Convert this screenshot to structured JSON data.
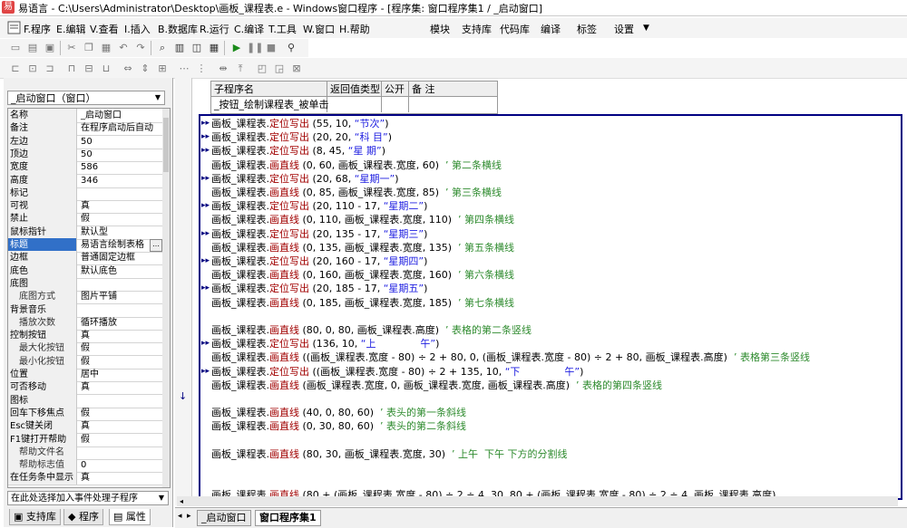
{
  "window": {
    "title": "易语言 - C:\\Users\\Administrator\\Desktop\\画板_课程表.e - Windows窗口程序 - [程序集: 窗口程序集1 / _启动窗口]"
  },
  "menu": {
    "items": [
      "F.程序",
      "E.编辑",
      "V.查看",
      "I.插入",
      "B.数据库",
      "R.运行",
      "C.编译",
      "T.工具",
      "W.窗口",
      "H.帮助"
    ],
    "right_items": [
      "模块",
      "支持库",
      "代码库",
      "编译",
      "标签",
      "设置"
    ]
  },
  "left_panel": {
    "object_select": "_启动窗口（窗口）",
    "properties": [
      {
        "name": "名称",
        "value": "_启动窗口",
        "sub": false
      },
      {
        "name": "备注",
        "value": "在程序启动后自动",
        "sub": false
      },
      {
        "name": "左边",
        "value": "50",
        "sub": false
      },
      {
        "name": "顶边",
        "value": "50",
        "sub": false
      },
      {
        "name": "宽度",
        "value": "586",
        "sub": false
      },
      {
        "name": "高度",
        "value": "346",
        "sub": false
      },
      {
        "name": "标记",
        "value": "",
        "sub": false
      },
      {
        "name": "可视",
        "value": "真",
        "sub": false
      },
      {
        "name": "禁止",
        "value": "假",
        "sub": false
      },
      {
        "name": "鼠标指针",
        "value": "默认型",
        "sub": false
      },
      {
        "name": "标题",
        "value": "易语言绘制表格",
        "sub": false,
        "selected": true
      },
      {
        "name": "边框",
        "value": "普通固定边框",
        "sub": false
      },
      {
        "name": "底色",
        "value": "默认底色",
        "sub": false
      },
      {
        "name": "底图",
        "value": "",
        "sub": false
      },
      {
        "name": "底图方式",
        "value": "图片平铺",
        "sub": true
      },
      {
        "name": "背景音乐",
        "value": "",
        "sub": false
      },
      {
        "name": "播放次数",
        "value": "循环播放",
        "sub": true
      },
      {
        "name": "控制按钮",
        "value": "真",
        "sub": false
      },
      {
        "name": "最大化按钮",
        "value": "假",
        "sub": true
      },
      {
        "name": "最小化按钮",
        "value": "假",
        "sub": true
      },
      {
        "name": "位置",
        "value": "居中",
        "sub": false
      },
      {
        "name": "可否移动",
        "value": "真",
        "sub": false
      },
      {
        "name": "图标",
        "value": "",
        "sub": false
      },
      {
        "name": "回车下移焦点",
        "value": "假",
        "sub": false
      },
      {
        "name": "Esc键关闭",
        "value": "真",
        "sub": false
      },
      {
        "name": "F1键打开帮助",
        "value": "假",
        "sub": false
      },
      {
        "name": "帮助文件名",
        "value": "",
        "sub": true
      },
      {
        "name": "帮助标志值",
        "value": "0",
        "sub": true
      },
      {
        "name": "在任务条中显示",
        "value": "真",
        "sub": false
      }
    ],
    "event_select": "在此处选择加入事件处理子程序",
    "tabs": [
      "支持库",
      "程序",
      "属性"
    ]
  },
  "sub_table": {
    "headers": [
      "子程序名",
      "返回值类型",
      "公开",
      "备 注"
    ],
    "name": "_按钮_绘制课程表_被单击"
  },
  "code_lines": [
    {
      "mark": true,
      "parts": [
        [
          "画板_课程表.",
          ""
        ],
        [
          "定位写出",
          "kw"
        ],
        [
          " (55, 10, ",
          ""
        ],
        [
          "“节次”",
          "str"
        ],
        [
          ")",
          ""
        ]
      ]
    },
    {
      "mark": true,
      "parts": [
        [
          "画板_课程表.",
          ""
        ],
        [
          "定位写出",
          "kw"
        ],
        [
          " (20, 20, ",
          ""
        ],
        [
          "“科 目”",
          "str"
        ],
        [
          ")",
          ""
        ]
      ]
    },
    {
      "mark": true,
      "parts": [
        [
          "画板_课程表.",
          ""
        ],
        [
          "定位写出",
          "kw"
        ],
        [
          " (8, 45, ",
          ""
        ],
        [
          "“星 期”",
          "str"
        ],
        [
          ")",
          ""
        ]
      ]
    },
    {
      "mark": false,
      "parts": [
        [
          "画板_课程表.",
          ""
        ],
        [
          "画直线",
          "kw"
        ],
        [
          " (0, 60, 画板_课程表.宽度, 60)  ",
          ""
        ],
        [
          "’ 第二条横线",
          "cmt"
        ]
      ]
    },
    {
      "mark": true,
      "parts": [
        [
          "画板_课程表.",
          ""
        ],
        [
          "定位写出",
          "kw"
        ],
        [
          " (20, 68, ",
          ""
        ],
        [
          "“星期一”",
          "str"
        ],
        [
          ")",
          ""
        ]
      ]
    },
    {
      "mark": false,
      "parts": [
        [
          "画板_课程表.",
          ""
        ],
        [
          "画直线",
          "kw"
        ],
        [
          " (0, 85, 画板_课程表.宽度, 85)  ",
          ""
        ],
        [
          "’ 第三条横线",
          "cmt"
        ]
      ]
    },
    {
      "mark": true,
      "parts": [
        [
          "画板_课程表.",
          ""
        ],
        [
          "定位写出",
          "kw"
        ],
        [
          " (20, 110 - 17, ",
          ""
        ],
        [
          "“星期二”",
          "str"
        ],
        [
          ")",
          ""
        ]
      ]
    },
    {
      "mark": false,
      "parts": [
        [
          "画板_课程表.",
          ""
        ],
        [
          "画直线",
          "kw"
        ],
        [
          " (0, 110, 画板_课程表.宽度, 110)  ",
          ""
        ],
        [
          "’ 第四条横线",
          "cmt"
        ]
      ]
    },
    {
      "mark": true,
      "parts": [
        [
          "画板_课程表.",
          ""
        ],
        [
          "定位写出",
          "kw"
        ],
        [
          " (20, 135 - 17, ",
          ""
        ],
        [
          "“星期三”",
          "str"
        ],
        [
          ")",
          ""
        ]
      ]
    },
    {
      "mark": false,
      "parts": [
        [
          "画板_课程表.",
          ""
        ],
        [
          "画直线",
          "kw"
        ],
        [
          " (0, 135, 画板_课程表.宽度, 135)  ",
          ""
        ],
        [
          "’ 第五条横线",
          "cmt"
        ]
      ]
    },
    {
      "mark": true,
      "parts": [
        [
          "画板_课程表.",
          ""
        ],
        [
          "定位写出",
          "kw"
        ],
        [
          " (20, 160 - 17, ",
          ""
        ],
        [
          "“星期四”",
          "str"
        ],
        [
          ")",
          ""
        ]
      ]
    },
    {
      "mark": false,
      "parts": [
        [
          "画板_课程表.",
          ""
        ],
        [
          "画直线",
          "kw"
        ],
        [
          " (0, 160, 画板_课程表.宽度, 160)  ",
          ""
        ],
        [
          "’ 第六条横线",
          "cmt"
        ]
      ]
    },
    {
      "mark": true,
      "parts": [
        [
          "画板_课程表.",
          ""
        ],
        [
          "定位写出",
          "kw"
        ],
        [
          " (20, 185 - 17, ",
          ""
        ],
        [
          "“星期五”",
          "str"
        ],
        [
          ")",
          ""
        ]
      ]
    },
    {
      "mark": false,
      "parts": [
        [
          "画板_课程表.",
          ""
        ],
        [
          "画直线",
          "kw"
        ],
        [
          " (0, 185, 画板_课程表.宽度, 185)  ",
          ""
        ],
        [
          "’ 第七条横线",
          "cmt"
        ]
      ]
    },
    {
      "mark": false,
      "parts": [
        [
          "",
          ""
        ]
      ]
    },
    {
      "mark": false,
      "parts": [
        [
          "画板_课程表.",
          ""
        ],
        [
          "画直线",
          "kw"
        ],
        [
          " (80, 0, 80, 画板_课程表.高度)  ",
          ""
        ],
        [
          "’ 表格的第二条竖线",
          "cmt"
        ]
      ]
    },
    {
      "mark": true,
      "parts": [
        [
          "画板_课程表.",
          ""
        ],
        [
          "定位写出",
          "kw"
        ],
        [
          " (136, 10, ",
          ""
        ],
        [
          "“上              午”",
          "str"
        ],
        [
          ")",
          ""
        ]
      ]
    },
    {
      "mark": false,
      "parts": [
        [
          "画板_课程表.",
          ""
        ],
        [
          "画直线",
          "kw"
        ],
        [
          " ((画板_课程表.宽度 - 80) ÷ 2 + 80, 0, (画板_课程表.宽度 - 80) ÷ 2 + 80, 画板_课程表.高度)  ",
          ""
        ],
        [
          "’ 表格第三条竖线",
          "cmt"
        ]
      ]
    },
    {
      "mark": true,
      "parts": [
        [
          "画板_课程表.",
          ""
        ],
        [
          "定位写出",
          "kw"
        ],
        [
          " ((画板_课程表.宽度 - 80) ÷ 2 + 135, 10, ",
          ""
        ],
        [
          "“下              午”",
          "str"
        ],
        [
          ")",
          ""
        ]
      ]
    },
    {
      "mark": false,
      "parts": [
        [
          "画板_课程表.",
          ""
        ],
        [
          "画直线",
          "kw"
        ],
        [
          " (画板_课程表.宽度, 0, 画板_课程表.宽度, 画板_课程表.高度)  ",
          ""
        ],
        [
          "’ 表格的第四条竖线",
          "cmt"
        ]
      ]
    },
    {
      "mark": false,
      "parts": [
        [
          "",
          ""
        ]
      ]
    },
    {
      "mark": false,
      "parts": [
        [
          "画板_课程表.",
          ""
        ],
        [
          "画直线",
          "kw"
        ],
        [
          " (40, 0, 80, 60)  ",
          ""
        ],
        [
          "’ 表头的第一条斜线",
          "cmt"
        ]
      ]
    },
    {
      "mark": false,
      "parts": [
        [
          "画板_课程表.",
          ""
        ],
        [
          "画直线",
          "kw"
        ],
        [
          " (0, 30, 80, 60)  ",
          ""
        ],
        [
          "’ 表头的第二条斜线",
          "cmt"
        ]
      ]
    },
    {
      "mark": false,
      "parts": [
        [
          "",
          ""
        ]
      ]
    },
    {
      "mark": false,
      "parts": [
        [
          "画板_课程表.",
          ""
        ],
        [
          "画直线",
          "kw"
        ],
        [
          " (80, 30, 画板_课程表.宽度, 30)  ",
          ""
        ],
        [
          "’ 上午  下午 下方的分割线",
          "cmt"
        ]
      ]
    },
    {
      "mark": false,
      "parts": [
        [
          "",
          ""
        ]
      ]
    },
    {
      "mark": false,
      "parts": [
        [
          "",
          ""
        ]
      ]
    },
    {
      "mark": false,
      "parts": [
        [
          "画板_课程表.",
          ""
        ],
        [
          "画直线",
          "kw"
        ],
        [
          " (80 + (画板_课程表.宽度 - 80) ÷ 2 ÷ 4, 30, 80 + (画板_课程表.宽度 - 80) ÷ 2 ÷ 4, 画板_课程表.高度)",
          ""
        ]
      ]
    }
  ],
  "bottom_tabs": [
    "_启动窗口",
    "窗口程序集1"
  ]
}
